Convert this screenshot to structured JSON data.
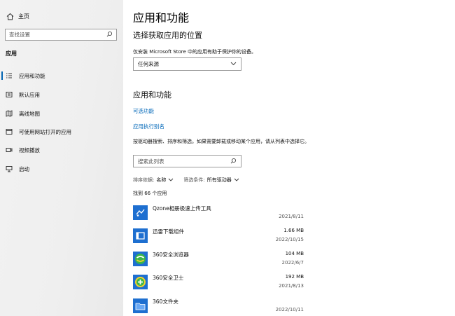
{
  "sidebar": {
    "home_label": "主页",
    "search_placeholder": "查找设置",
    "section_title": "应用",
    "items": [
      {
        "label": "应用和功能",
        "icon": "list-icon",
        "active": true
      },
      {
        "label": "默认应用",
        "icon": "default-apps-icon",
        "active": false
      },
      {
        "label": "离线地图",
        "icon": "map-icon",
        "active": false
      },
      {
        "label": "可使用网站打开的应用",
        "icon": "web-apps-icon",
        "active": false
      },
      {
        "label": "视频播放",
        "icon": "video-icon",
        "active": false
      },
      {
        "label": "启动",
        "icon": "startup-icon",
        "active": false
      }
    ]
  },
  "main": {
    "title": "应用和功能",
    "install_location": {
      "heading": "选择获取应用的位置",
      "description": "仅安装 Microsoft Store 中的应用有助于保护你的设备。",
      "selected_value": "任何来源"
    },
    "apps": {
      "heading": "应用和功能",
      "optional_features_link": "可选功能",
      "app_aliases_link": "应用执行别名",
      "filter_description": "按驱动器搜索、排序和筛选。如果需要卸载或移动某个应用，请从列表中选择它。",
      "search_placeholder": "搜索此列表",
      "sort_label": "排序依据:",
      "sort_value": "名称",
      "filter_label": "筛选条件:",
      "filter_value": "所有驱动器",
      "count_text": "找到 66 个应用",
      "list": [
        {
          "name": "Qzone相册极速上传工具",
          "size": "",
          "date": "2021/8/11",
          "icon": "qzone-upload-icon"
        },
        {
          "name": "迅雷下载组件",
          "size": "1.66 MB",
          "date": "2022/10/15",
          "icon": "thunder-component-icon"
        },
        {
          "name": "360安全浏览器",
          "size": "104 MB",
          "date": "2022/6/7",
          "icon": "360-browser-icon"
        },
        {
          "name": "360安全卫士",
          "size": "192 MB",
          "date": "2021/8/13",
          "icon": "360-safe-icon"
        },
        {
          "name": "360文件夹",
          "size": "",
          "date": "2022/10/11",
          "icon": "360-folder-icon"
        }
      ]
    }
  },
  "colors": {
    "accent": "#0063b1",
    "link": "#0067b8",
    "app_tile_blue": "#1e6fd0",
    "green_360": "#3ab54a"
  }
}
